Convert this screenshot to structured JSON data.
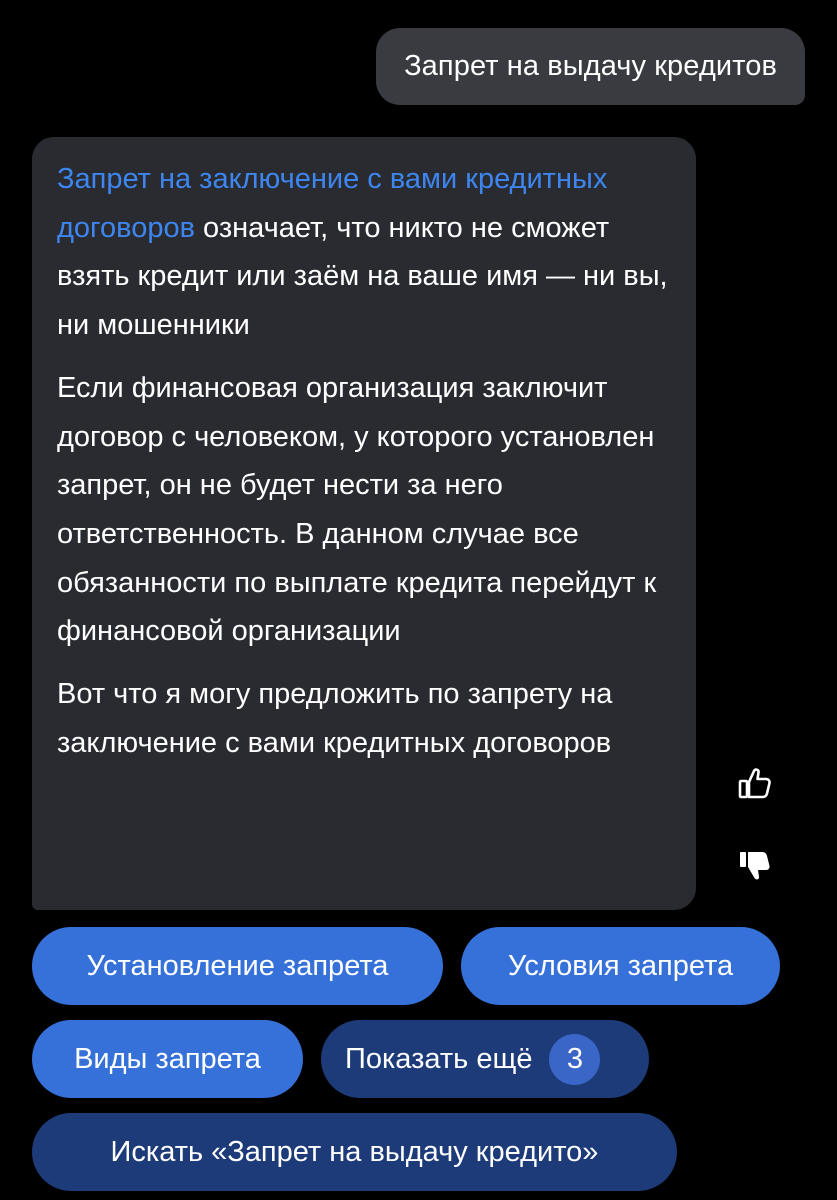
{
  "user_message": {
    "text": "Запрет на выдачу кредитов"
  },
  "bot_message": {
    "p1_link": "Запрет на заключение с вами кредитных договоров",
    "p1_rest": " означает, что никто не сможет взять кредит или заём на ваше имя — ни вы, ни мошенники",
    "p2": "Если финансовая организация заключит договор с человеком, у которого установлен запрет, он не будет нести за него ответственность. В данном случае все обязанности по выплате кредита перейдут к финансовой организации",
    "p3": "Вот что я могу предложить по запрету на заключение с вами кредитных договоров"
  },
  "feedback": {
    "like_icon": "thumbs-up-outline",
    "dislike_icon": "thumbs-down-filled"
  },
  "suggestions": {
    "chip1": "Установление запрета",
    "chip2": "Условия запрета",
    "chip3": "Виды запрета",
    "show_more": "Показать ещё",
    "show_more_count": "3",
    "search": "Искать «Запрет на выдачу кредито»"
  },
  "colors": {
    "background": "#000000",
    "user_bubble": "#3a3b40",
    "bot_bubble": "#2a2b31",
    "link": "#3d86f0",
    "chip_primary": "#3571d9",
    "chip_secondary": "#1d3b79"
  }
}
